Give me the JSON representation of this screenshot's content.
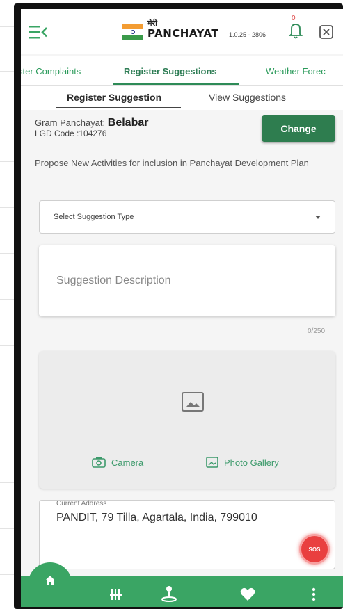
{
  "app": {
    "logo_small": "मेरी",
    "logo_main": "PANCHAYAT",
    "version": "1.0.25 - 2806",
    "notification_count": "0"
  },
  "tabs": [
    {
      "label": "ster Complaints"
    },
    {
      "label": "Register Suggestions"
    },
    {
      "label": "Weather Forec"
    }
  ],
  "subtabs": [
    {
      "label": "Register Suggestion"
    },
    {
      "label": "View Suggestions"
    }
  ],
  "gp": {
    "label": "Gram Panchayat:",
    "name": "Belabar",
    "lgd": "LGD Code :104276",
    "change_label": "Change"
  },
  "propose_text": "Propose New Activities for inclusion in  Panchayat Development Plan",
  "form": {
    "select_placeholder": "Select Suggestion Type",
    "description_placeholder": "Suggestion Description",
    "counter": "0/250",
    "camera_label": "Camera",
    "gallery_label": "Photo Gallery",
    "address_label": "Current Address",
    "address_value": "PANDIT, 79 Tilla, Agartala, India, 799010"
  },
  "sos_label": "SOS",
  "colors": {
    "primary_green": "#3aa564",
    "button_green": "#2e7d4f",
    "sos_red": "#e93f3f"
  },
  "nav_icons": [
    "home-icon",
    "dashboard-icon",
    "location-icon",
    "heart-icon",
    "more-icon"
  ]
}
